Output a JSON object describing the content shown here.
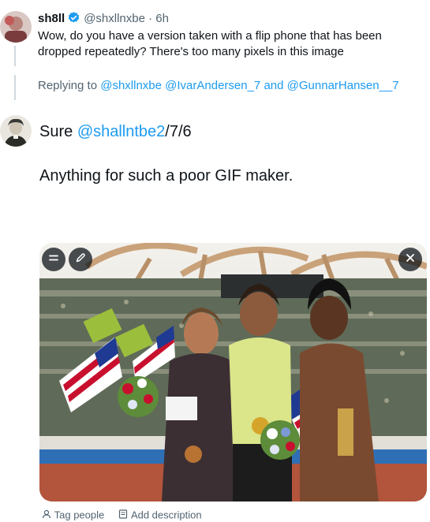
{
  "reply_context": {
    "author_name": "sh8ll",
    "author_handle": "@shxllnxbe",
    "separator": "·",
    "time": "6h",
    "text": "Wow, do you have a version taken with a flip phone that has been dropped repeatedly? There's too many pixels in this image",
    "replying_label": "Replying to",
    "replying_handles": "@shxllnxbe @IvarAndersen_7",
    "replying_and": "and",
    "replying_last": "@GunnarHansen__7"
  },
  "compose": {
    "prefix": "Sure",
    "mention": "@shallntbe2",
    "suffix": "/7/6",
    "line2": "Anything for such a poor GIF maker."
  },
  "media_actions": {
    "tag_people": "Tag people",
    "add_description": "Add description"
  },
  "icons": {
    "verified": "verified-badge-icon",
    "edit_menu": "menu-lines-icon",
    "edit": "pencil-icon",
    "close": "close-icon",
    "tag": "person-icon",
    "description": "document-icon"
  },
  "colors": {
    "accent": "#1d9bf0",
    "secondary_text": "#536471",
    "thread_line": "#cfd9de"
  }
}
